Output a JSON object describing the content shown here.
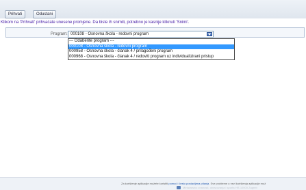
{
  "toolbar": {
    "accept_label": "Prihvati",
    "cancel_label": "Odustani"
  },
  "notice": "Klikom na 'Prihvati' prihvaćate unesene promjene. Da biste ih snimili, potrebno je kasnije kliknuti 'Snimi'.",
  "form": {
    "program_label": "Program:",
    "selected_value": "000108 - Osnovna škola - redovni program",
    "options": [
      {
        "label": "--- Odaberite program ---",
        "selected": false
      },
      {
        "label": "000108 - Osnovna škola - redovni program",
        "selected": true
      },
      {
        "label": "000958 - Osnovna škola - članak 4 / prilagođeni program",
        "selected": false
      },
      {
        "label": "000968 - Osnovna škola - članak 4 / redoviti program uz individualizirani pristup",
        "selected": false
      }
    ]
  },
  "footer": {
    "text_before": "Za korištenje aplikacije možete koristiti ",
    "link_text": "pomoć i često postavljena pitanja",
    "text_after": ". Sve probleme u vezi korištenja aplikacije mož",
    "faint_text": "Ministarstvo znanosti, obrazovanja i sporta    HR-10000 Zagreb"
  },
  "colors": {
    "notice": "#4a21a8",
    "selected_option_bg": "#3399ff",
    "link": "#2a5db0"
  }
}
